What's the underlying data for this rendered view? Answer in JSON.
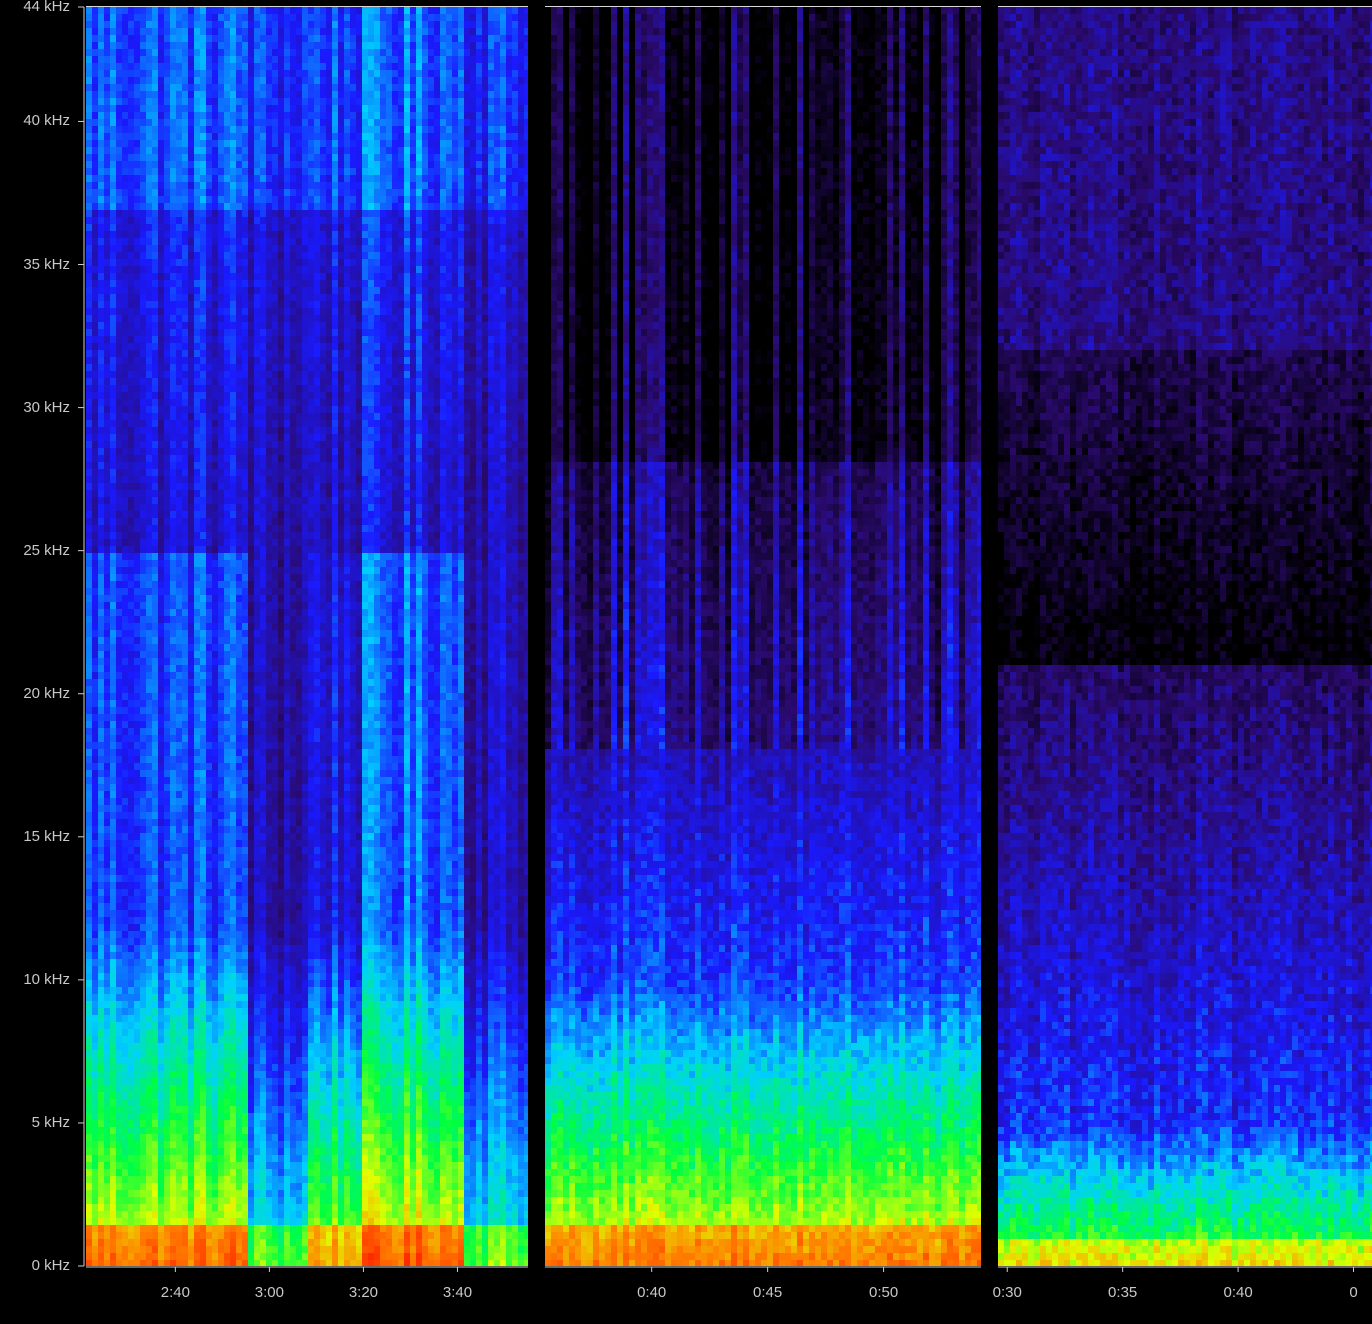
{
  "chart_data": {
    "type": "heatmap",
    "y_axis": {
      "ticks": [
        "0 kHz",
        "5 kHz",
        "10 kHz",
        "15 kHz",
        "20 kHz",
        "25 kHz",
        "30 kHz",
        "35 kHz",
        "40 kHz",
        "44 kHz"
      ],
      "tick_values_khz": [
        0,
        5,
        10,
        15,
        20,
        25,
        30,
        35,
        40,
        44
      ],
      "ylim": [
        0,
        44
      ]
    },
    "panels": [
      {
        "id": "panel-1",
        "x_ticks": [
          "2:40",
          "3:00",
          "3:20",
          "3:40"
        ],
        "x_tick_seconds": [
          160,
          180,
          200,
          220
        ],
        "xlim_seconds": [
          141,
          235
        ]
      },
      {
        "id": "panel-2",
        "x_ticks": [
          "0:40",
          "0:45",
          "0:50"
        ],
        "x_tick_seconds": [
          40,
          45,
          50
        ],
        "xlim_seconds": [
          35.4,
          54.2
        ]
      },
      {
        "id": "panel-3",
        "x_ticks": [
          "0:30",
          "0:35",
          "0:40",
          "0"
        ],
        "x_tick_seconds": [
          30,
          35,
          40,
          45
        ],
        "xlim_seconds": [
          29.6,
          45.8
        ]
      }
    ],
    "colormap": [
      "#000000",
      "#2a0a6e",
      "#1a1aff",
      "#00d0ff",
      "#00ff40",
      "#e0ff00",
      "#ff8000",
      "#ff2000"
    ]
  }
}
